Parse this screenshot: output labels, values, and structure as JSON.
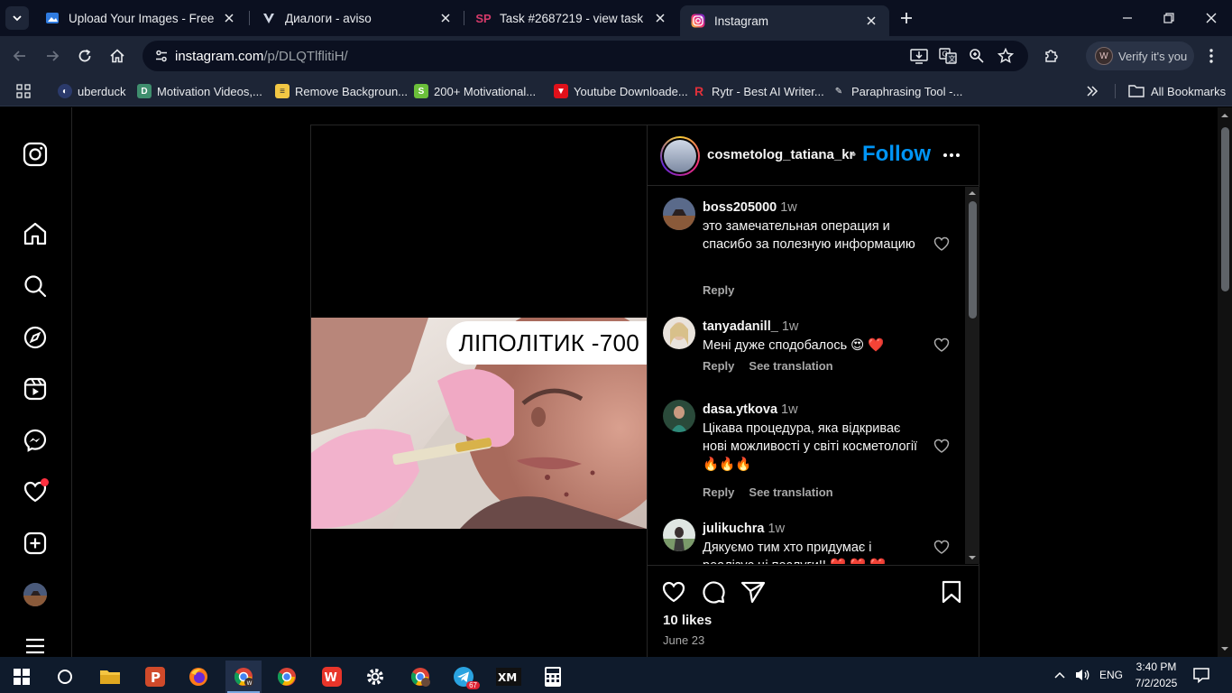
{
  "browser": {
    "tabs": [
      {
        "title": "Upload Your Images - Free Imag",
        "favicon": "image-upload-icon",
        "active": false
      },
      {
        "title": "Диалоги - aviso",
        "favicon": "aviso-icon",
        "active": false
      },
      {
        "title": "Task #2687219 - view task",
        "favicon": "sp-icon",
        "active": false
      },
      {
        "title": "Instagram",
        "favicon": "instagram-icon",
        "active": true
      }
    ],
    "url_host": "instagram.com",
    "url_path": "/p/DLQTlflitiH/",
    "verify_label": "Verify it's you",
    "verify_avatar_letter": "W",
    "bookmarks": [
      {
        "label": "uberduck",
        "color": "#1e2638"
      },
      {
        "label": "Motivation Videos,...",
        "color": "#3f8e6e"
      },
      {
        "label": "Remove Backgroun...",
        "color": "#f2c744"
      },
      {
        "label": "200+ Motivational...",
        "color": "#6bbf3a"
      },
      {
        "label": "Youtube Downloade...",
        "color": "#e0101a"
      },
      {
        "label": "Rytr - Best AI Writer...",
        "color": "#d8202a"
      },
      {
        "label": "Paraphrasing Tool -...",
        "color": "#1d2536"
      }
    ],
    "all_bookmarks_label": "All Bookmarks"
  },
  "post": {
    "username": "cosmetolog_tatiana_kr",
    "separator": "•",
    "follow_label": "Follow",
    "photo_caption": "ЛІПОЛІТИК -700",
    "likes": "10 likes",
    "date": "June 23"
  },
  "comments": [
    {
      "user": "boss205000",
      "time": "1w",
      "text": "это замечательная операция и спасибо за полезную информацию",
      "reply": "Reply",
      "translation": ""
    },
    {
      "user": "tanyadanill_",
      "time": "1w",
      "text": "Мені дуже сподобалось 😍 ❤️",
      "reply": "Reply",
      "translation": "See translation"
    },
    {
      "user": "dasa.ytkova",
      "time": "1w",
      "text": "Цікава процедура, яка відкриває нові можливості у світі косметології🔥🔥🔥",
      "reply": "Reply",
      "translation": "See translation"
    },
    {
      "user": "julikuchra",
      "time": "1w",
      "text": "Дякуємо тим хто придумає і реалізує ці послуги!! ❤️ ❤️ ❤️",
      "reply": "",
      "translation": ""
    }
  ],
  "taskbar": {
    "language": "ENG",
    "time": "3:40 PM",
    "date": "7/2/2025",
    "telegram_badge": "67"
  },
  "colors": {
    "instagram_blue": "#0095f6",
    "notification_red": "#ff3040",
    "chrome_dark": "#1d2536"
  }
}
